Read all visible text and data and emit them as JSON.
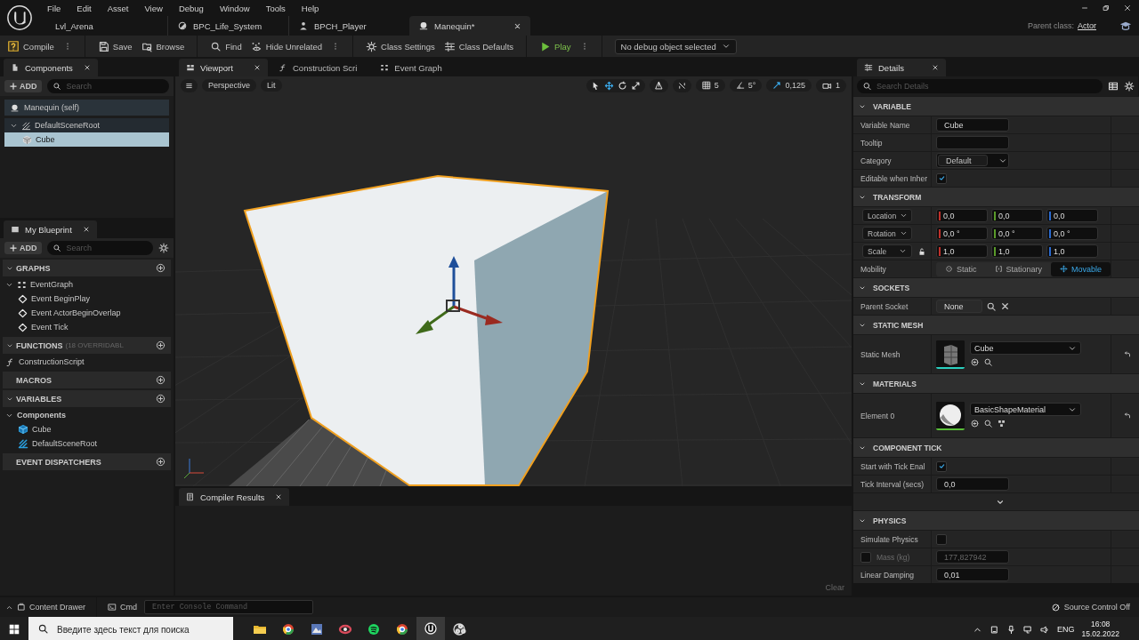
{
  "menu": [
    "File",
    "Edit",
    "Asset",
    "View",
    "Debug",
    "Window",
    "Tools",
    "Help"
  ],
  "doc_tabs": [
    {
      "label": "Lvl_Arena",
      "kind": "level",
      "selected": false
    },
    {
      "label": "BPC_Life_System",
      "kind": "component",
      "selected": false
    },
    {
      "label": "BPCH_Player",
      "kind": "character",
      "selected": false
    },
    {
      "label": "Manequin*",
      "kind": "actor",
      "selected": true
    }
  ],
  "parent_class": {
    "label": "Parent class:",
    "value": "Actor"
  },
  "toolbar_groups": [
    {
      "items": [
        {
          "kind": "compile",
          "label": "Compile",
          "more": true
        }
      ]
    },
    {
      "items": [
        {
          "kind": "save",
          "label": "Save",
          "more": false
        },
        {
          "kind": "browse",
          "label": "Browse",
          "more": false
        }
      ]
    },
    {
      "items": [
        {
          "kind": "find",
          "label": "Find",
          "more": false
        },
        {
          "kind": "hide",
          "label": "Hide Unrelated",
          "more": true
        }
      ]
    },
    {
      "items": [
        {
          "kind": "settings",
          "label": "Class Settings",
          "more": false
        },
        {
          "kind": "defaults",
          "label": "Class Defaults",
          "more": false
        }
      ]
    },
    {
      "items": [
        {
          "kind": "play",
          "label": "Play",
          "more": true
        }
      ]
    }
  ],
  "debug_filter": {
    "value": "No debug object selected"
  },
  "components": {
    "title": "Components",
    "add": "ADD",
    "search_placeholder": "Search",
    "self": "Manequin  (self)",
    "tree": [
      {
        "label": "DefaultSceneRoot",
        "kind": "scene",
        "expanded": true,
        "selected": false,
        "children": [
          {
            "label": "Cube",
            "kind": "mesh",
            "selected": true
          }
        ]
      }
    ]
  },
  "my_blueprint": {
    "title": "My Blueprint",
    "add": "ADD",
    "search_placeholder": "Search",
    "sections": [
      {
        "title": "GRAPHS",
        "expanded": true,
        "items": [
          {
            "label": "EventGraph",
            "kind": "graph",
            "expanded": true,
            "children": [
              {
                "label": "Event BeginPlay",
                "kind": "event"
              },
              {
                "label": "Event ActorBeginOverlap",
                "kind": "event"
              },
              {
                "label": "Event Tick",
                "kind": "event"
              }
            ]
          }
        ]
      },
      {
        "title": "FUNCTIONS",
        "note": "(18 OVERRIDABL",
        "expanded": true,
        "items": [
          {
            "label": "ConstructionScript",
            "kind": "function"
          }
        ]
      },
      {
        "title": "MACROS"
      },
      {
        "title": "VARIABLES",
        "expanded": true,
        "items": [
          {
            "label": "Components",
            "kind": "category",
            "expanded": true,
            "children": [
              {
                "label": "Cube",
                "kind": "mesh-var"
              },
              {
                "label": "DefaultSceneRoot",
                "kind": "scene-var"
              }
            ]
          }
        ]
      },
      {
        "title": "EVENT DISPATCHERS"
      }
    ]
  },
  "editor_tabs": [
    {
      "label": "Viewport",
      "kind": "viewport",
      "selected": true
    },
    {
      "label": "Construction Scri",
      "kind": "function",
      "selected": false
    },
    {
      "label": "Event Graph",
      "kind": "graph",
      "selected": false
    }
  ],
  "viewport_toolbar": {
    "view": "Perspective",
    "shading": "Lit",
    "tools": [
      {
        "kind": "select",
        "selected": false
      },
      {
        "kind": "move",
        "selected": true
      },
      {
        "kind": "rotate",
        "selected": false
      },
      {
        "kind": "scale",
        "selected": false
      }
    ],
    "grid_snap": "5",
    "rotation_snap": "5°",
    "scale_snap": "0,125",
    "camera_speed": "1"
  },
  "compiler_results": {
    "title": "Compiler Results",
    "clear": "Clear"
  },
  "details": {
    "title": "Details",
    "search_placeholder": "Search Details",
    "sections": [
      {
        "title": "VARIABLE",
        "expanded": true,
        "rows": [
          {
            "kind": "text",
            "label": "Variable Name",
            "value": "Cube"
          },
          {
            "kind": "text",
            "label": "Tooltip"
          },
          {
            "kind": "combo",
            "label": "Category",
            "value": "Default"
          },
          {
            "kind": "checkbox",
            "label": "Editable when Inher",
            "checked": true
          }
        ]
      },
      {
        "title": "TRANSFORM",
        "expanded": true,
        "rows": [
          {
            "kind": "vector",
            "mode": "Location",
            "values": [
              "0,0",
              "0,0",
              "0,0"
            ]
          },
          {
            "kind": "vector",
            "mode": "Rotation",
            "values": [
              "0,0 °",
              "0,0 °",
              "0,0 °"
            ]
          },
          {
            "kind": "scale",
            "mode": "Scale",
            "values": [
              "1,0",
              "1,0",
              "1,0"
            ]
          },
          {
            "kind": "mobility",
            "label": "Mobility",
            "options": [
              {
                "label": "Static",
                "kind": "static",
                "selected": false
              },
              {
                "label": "Stationary",
                "kind": "stationary",
                "selected": false
              },
              {
                "label": "Movable",
                "kind": "movable",
                "selected": true
              }
            ]
          }
        ]
      },
      {
        "title": "SOCKETS",
        "expanded": true,
        "rows": [
          {
            "kind": "socket",
            "label": "Parent Socket",
            "value": "None"
          }
        ]
      },
      {
        "title": "STATIC MESH",
        "expanded": true,
        "rows": [
          {
            "kind": "mesh-asset",
            "label": "Static Mesh",
            "value": "Cube"
          }
        ]
      },
      {
        "title": "MATERIALS",
        "expanded": true,
        "rows": [
          {
            "kind": "material-asset",
            "label": "Element 0",
            "value": "BasicShapeMaterial"
          }
        ]
      },
      {
        "title": "COMPONENT TICK",
        "expanded": true,
        "rows": [
          {
            "kind": "checkbox",
            "label": "Start with Tick Enal",
            "checked": true
          },
          {
            "kind": "text",
            "label": "Tick Interval (secs)",
            "value": "0,0"
          },
          {
            "kind": "more"
          }
        ]
      },
      {
        "title": "PHYSICS",
        "expanded": true,
        "rows": [
          {
            "kind": "checkbox",
            "label": "Simulate Physics",
            "checked": false
          },
          {
            "kind": "override",
            "label": "Mass (kg)",
            "value": "177,827942",
            "checked": false,
            "disabled": true
          },
          {
            "kind": "text",
            "label": "Linear Damping",
            "value": "0,01"
          }
        ]
      }
    ]
  },
  "status_bar": {
    "content_drawer": "Content Drawer",
    "cmd": "Cmd",
    "console_placeholder": "Enter Console Command",
    "source_control": "Source Control Off"
  },
  "taskbar": {
    "search_placeholder": "Введите здесь текст для поиска",
    "apps": [
      {
        "kind": "folder",
        "active": false
      },
      {
        "kind": "browser",
        "active": false
      },
      {
        "kind": "picture",
        "active": false
      },
      {
        "kind": "ring",
        "active": false
      },
      {
        "kind": "music",
        "active": false
      },
      {
        "kind": "browser",
        "active": false
      },
      {
        "kind": "engine",
        "active": true
      },
      {
        "kind": "recorder",
        "active": false
      }
    ],
    "language": "ENG",
    "time": "16:08",
    "date": "15.02.2022"
  }
}
